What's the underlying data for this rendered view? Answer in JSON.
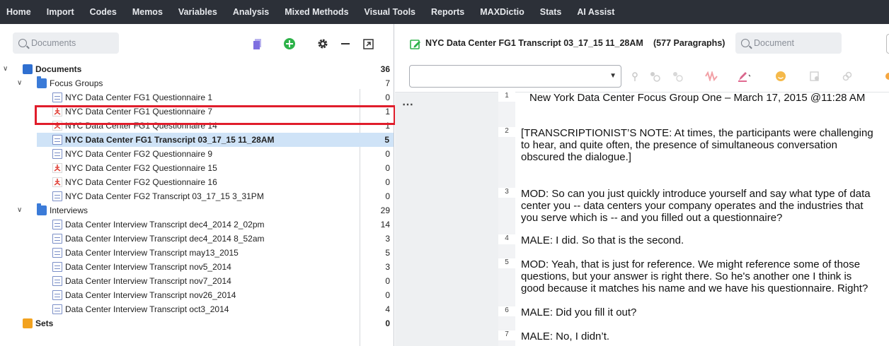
{
  "menu": [
    "Home",
    "Import",
    "Codes",
    "Memos",
    "Variables",
    "Analysis",
    "Mixed Methods",
    "Visual Tools",
    "Reports",
    "MAXDictio",
    "Stats",
    "AI Assist"
  ],
  "left_panel": {
    "search_placeholder": "Documents",
    "tree": [
      {
        "label": "Documents",
        "count": "36",
        "kind": "root"
      },
      {
        "label": "Focus Groups",
        "count": "7",
        "kind": "folder"
      },
      {
        "label": "NYC Data Center FG1 Questionnaire 1",
        "count": "0",
        "kind": "doc"
      },
      {
        "label": "NYC Data Center FG1 Questionnaire 7",
        "count": "1",
        "kind": "pdf"
      },
      {
        "label": "NYC Data Center FG1 Questionnaire 14",
        "count": "1",
        "kind": "pdf"
      },
      {
        "label": "NYC Data Center FG1 Transcript 03_17_15 11_28AM",
        "count": "5",
        "kind": "doc",
        "selected": true
      },
      {
        "label": "NYC Data Center FG2 Questionnaire 9",
        "count": "0",
        "kind": "doc"
      },
      {
        "label": "NYC Data Center FG2 Questionnaire 15",
        "count": "0",
        "kind": "pdf"
      },
      {
        "label": "NYC Data Center FG2 Questionnaire 16",
        "count": "0",
        "kind": "pdf"
      },
      {
        "label": "NYC Data Center FG2 Transcript 03_17_15 3_31PM",
        "count": "0",
        "kind": "doc"
      },
      {
        "label": "Interviews",
        "count": "29",
        "kind": "folder"
      },
      {
        "label": "Data Center Interview Transcript dec4_2014 2_02pm",
        "count": "14",
        "kind": "doc"
      },
      {
        "label": "Data Center Interview Transcript dec4_2014 8_52am",
        "count": "3",
        "kind": "doc"
      },
      {
        "label": "Data Center Interview Transcript may13_2015",
        "count": "5",
        "kind": "doc"
      },
      {
        "label": "Data Center Interview Transcript nov5_2014",
        "count": "3",
        "kind": "doc"
      },
      {
        "label": "Data Center Interview Transcript nov7_2014",
        "count": "0",
        "kind": "doc"
      },
      {
        "label": "Data Center Interview Transcript nov26_2014",
        "count": "0",
        "kind": "doc"
      },
      {
        "label": "Data Center Interview Transcript oct3_2014",
        "count": "4",
        "kind": "doc"
      },
      {
        "label": "Sets",
        "count": "0",
        "kind": "sets"
      }
    ]
  },
  "right_panel": {
    "title": "NYC Data Center FG1 Transcript 03_17_15 11_28AM",
    "paragraphs_label": "(577 Paragraphs)",
    "search_placeholder": "Document",
    "dropdown_value": "",
    "paragraphs": [
      {
        "num": "1",
        "text": "New York Data Center Focus Group One – March 17, 2015 @11:28 AM"
      },
      {
        "num": "2",
        "text": "[TRANSCRIPTIONIST’S NOTE:  At times, the participants were challenging\nto hear, and quite often, the presence of simultaneous conversation\nobscured the dialogue.]"
      },
      {
        "num": "3",
        "text": "MOD:  So can you just quickly introduce yourself and say what type of data\ncenter you -- data centers your company operates and the industries that\nyou serve which is -- and you filled out a questionnaire?"
      },
      {
        "num": "4",
        "text": "MALE:  I did.  So that is the second."
      },
      {
        "num": "5",
        "text": "MOD:  Yeah, that is just for reference.  We might reference some of those\nquestions, but your answer is right there.  So he's another one I think is\ngood because it matches his name and we have his questionnaire.  Right?"
      },
      {
        "num": "6",
        "text": "MALE:  Did you fill it out?"
      },
      {
        "num": "7",
        "text": "MALE:  No, I didn’t."
      }
    ]
  },
  "colors": {
    "menubar": "#2c3038",
    "selection_frame": "#e01d2b",
    "selected_row": "#cfe3f7",
    "add_green": "#2eb34a"
  }
}
